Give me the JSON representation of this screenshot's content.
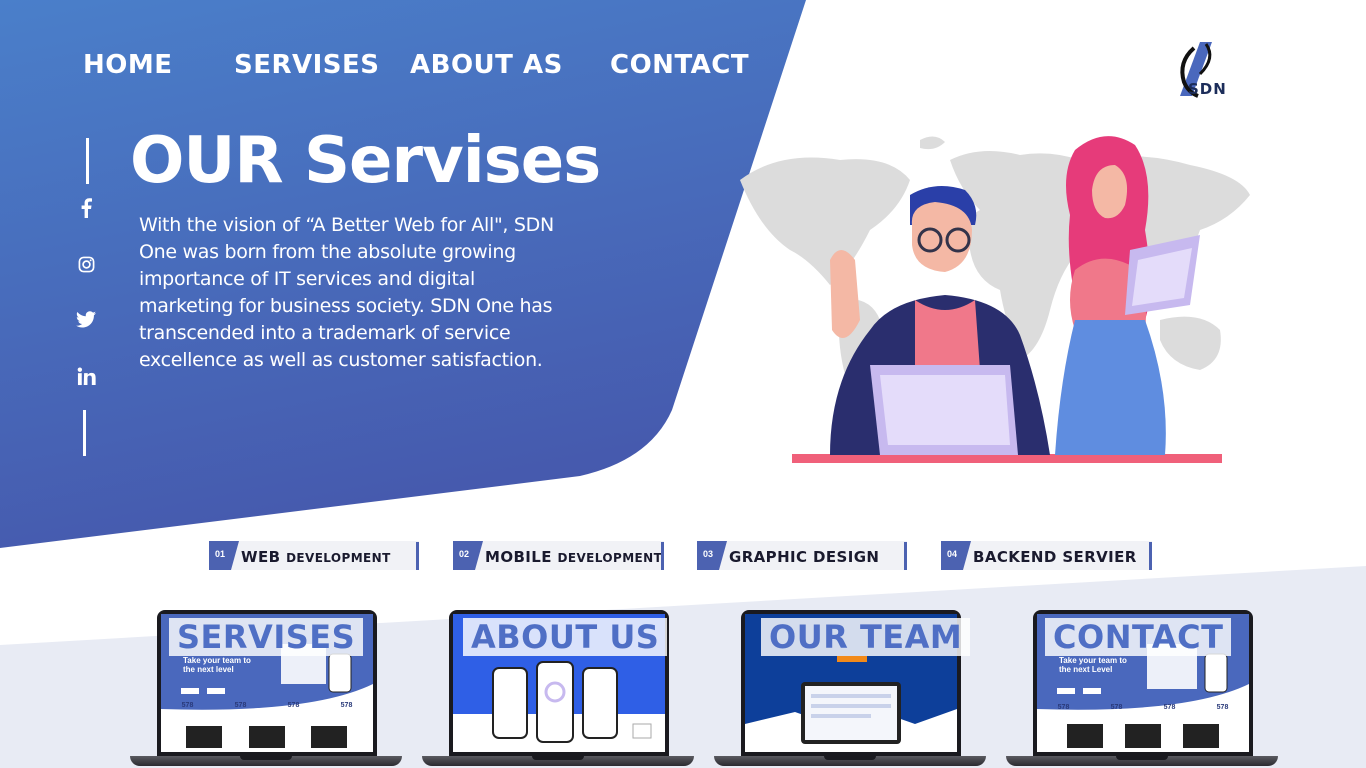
{
  "nav": {
    "home": "HOME",
    "services": "SERVISES",
    "about": "ABOUT AS",
    "contact": "CONTACT"
  },
  "logo": {
    "text": "SDN",
    "icon": "sdn-logo-icon"
  },
  "social": [
    {
      "name": "facebook-icon"
    },
    {
      "name": "instagram-icon"
    },
    {
      "name": "twitter-icon"
    },
    {
      "name": "linkedin-icon"
    }
  ],
  "hero": {
    "title": "OUR Servises",
    "description": "With the vision of “A Better Web for All\", SDN One was born from the absolute growing importance of IT services and digital marketing for business society. SDN One has transcended into a trademark of service excellence as well as customer satisfaction."
  },
  "services": [
    {
      "num": "01",
      "big": "WEB",
      "small": "DEVELOPMENT"
    },
    {
      "num": "02",
      "big": "MOBILE",
      "small": "DEVELOPMENT"
    },
    {
      "num": "03",
      "big": "GRAPHIC DESIGN",
      "small": ""
    },
    {
      "num": "04",
      "big": "BACKEND SERVIER",
      "small": ""
    }
  ],
  "cards": [
    {
      "caption": "SERVISES",
      "headline": "Take your team to the next level",
      "stats": [
        "578",
        "578",
        "578",
        "578"
      ]
    },
    {
      "caption": "ABOUT US"
    },
    {
      "caption": "OUR TEAM"
    },
    {
      "caption": "CONTACT",
      "headline": "Take your team to the next Level",
      "stats": [
        "578",
        "578",
        "578",
        "578"
      ]
    }
  ],
  "colors": {
    "primary": "#4a68bd",
    "accent": "#f0607a",
    "title": "#ffffff"
  }
}
